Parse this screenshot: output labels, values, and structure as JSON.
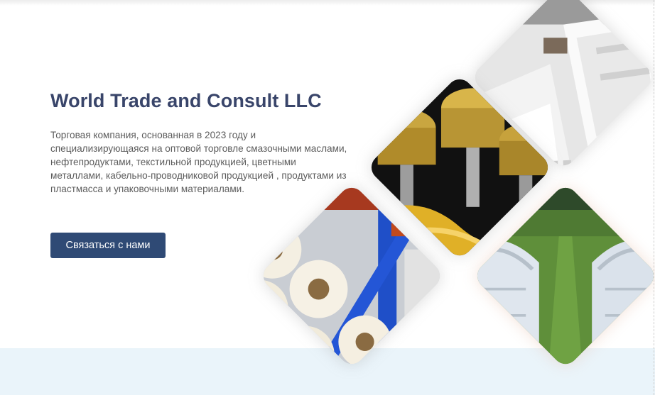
{
  "hero": {
    "title": "World Trade and Consult LLC",
    "description": "Торговая компания, основанная в 2023 году и специализирующаяся на оптовой торговле смазочными маслами, нефтепродуктами, текстильной продукцией, цветными металлами, кабельно-проводниковой продукцией , продуктами из пластмасса и упаковочными материалами.",
    "cta_label": "Связаться с нами"
  },
  "colors": {
    "title": "#39456a",
    "button": "#2f4a75",
    "band": "#eaf4fa"
  },
  "images": [
    {
      "name": "textile-bathrobes-image"
    },
    {
      "name": "engine-pistons-oil-image"
    },
    {
      "name": "plastic-film-rolls-image"
    },
    {
      "name": "greenhouses-image"
    }
  ]
}
